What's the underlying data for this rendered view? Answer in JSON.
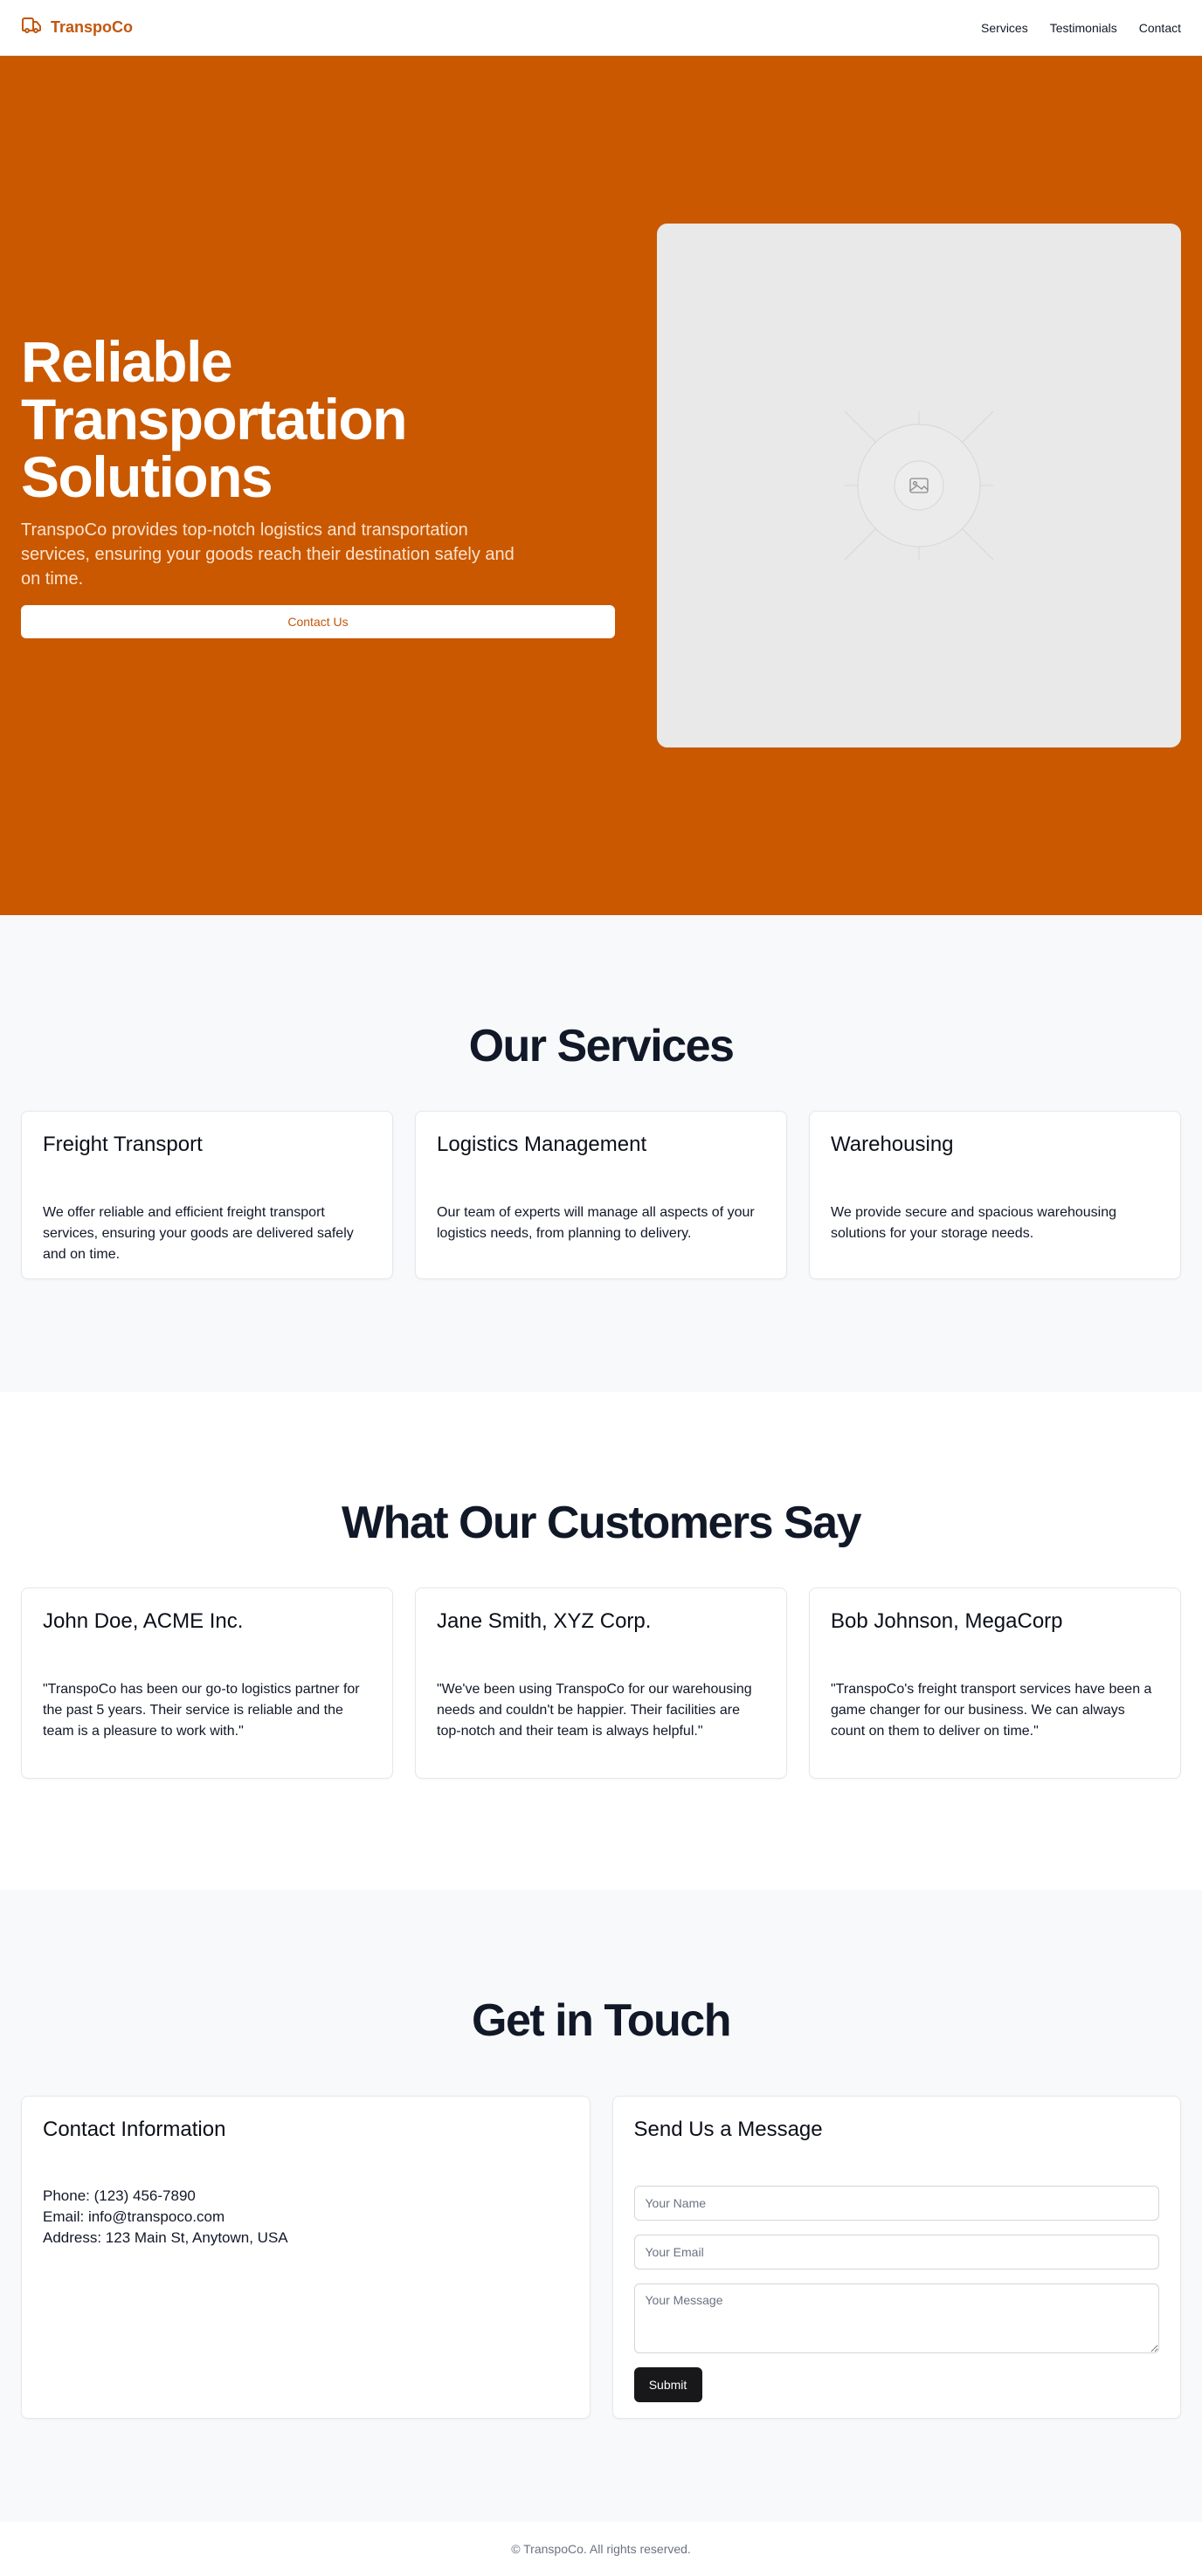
{
  "header": {
    "brand": "TranspoCo",
    "nav": [
      "Services",
      "Testimonials",
      "Contact"
    ]
  },
  "hero": {
    "title": "Reliable Transportation Solutions",
    "subtitle": "TranspoCo provides top-notch logistics and transportation services, ensuring your goods reach their destination safely and on time.",
    "cta": "Contact Us"
  },
  "services": {
    "title": "Our Services",
    "items": [
      {
        "title": "Freight Transport",
        "text": "We offer reliable and efficient freight transport services, ensuring your goods are delivered safely and on time."
      },
      {
        "title": "Logistics Management",
        "text": "Our team of experts will manage all aspects of your logistics needs, from planning to delivery."
      },
      {
        "title": "Warehousing",
        "text": "We provide secure and spacious warehousing solutions for your storage needs."
      }
    ]
  },
  "testimonials": {
    "title": "What Our Customers Say",
    "items": [
      {
        "author": "John Doe, ACME Inc.",
        "quote": "\"TranspoCo has been our go-to logistics partner for the past 5 years. Their service is reliable and the team is a pleasure to work with.\""
      },
      {
        "author": "Jane Smith, XYZ Corp.",
        "quote": "\"We've been using TranspoCo for our warehousing needs and couldn't be happier. Their facilities are top-notch and their team is always helpful.\""
      },
      {
        "author": "Bob Johnson, MegaCorp",
        "quote": "\"TranspoCo's freight transport services have been a game changer for our business. We can always count on them to deliver on time.\""
      }
    ]
  },
  "contact": {
    "title": "Get in Touch",
    "info": {
      "title": "Contact Information",
      "phone": "Phone: (123) 456-7890",
      "email": "Email: info@transpoco.com",
      "address": "Address: 123 Main St, Anytown, USA"
    },
    "form": {
      "title": "Send Us a Message",
      "name_placeholder": "Your Name",
      "email_placeholder": "Your Email",
      "message_placeholder": "Your Message",
      "submit": "Submit"
    }
  },
  "footer": {
    "text": "© TranspoCo. All rights reserved."
  }
}
